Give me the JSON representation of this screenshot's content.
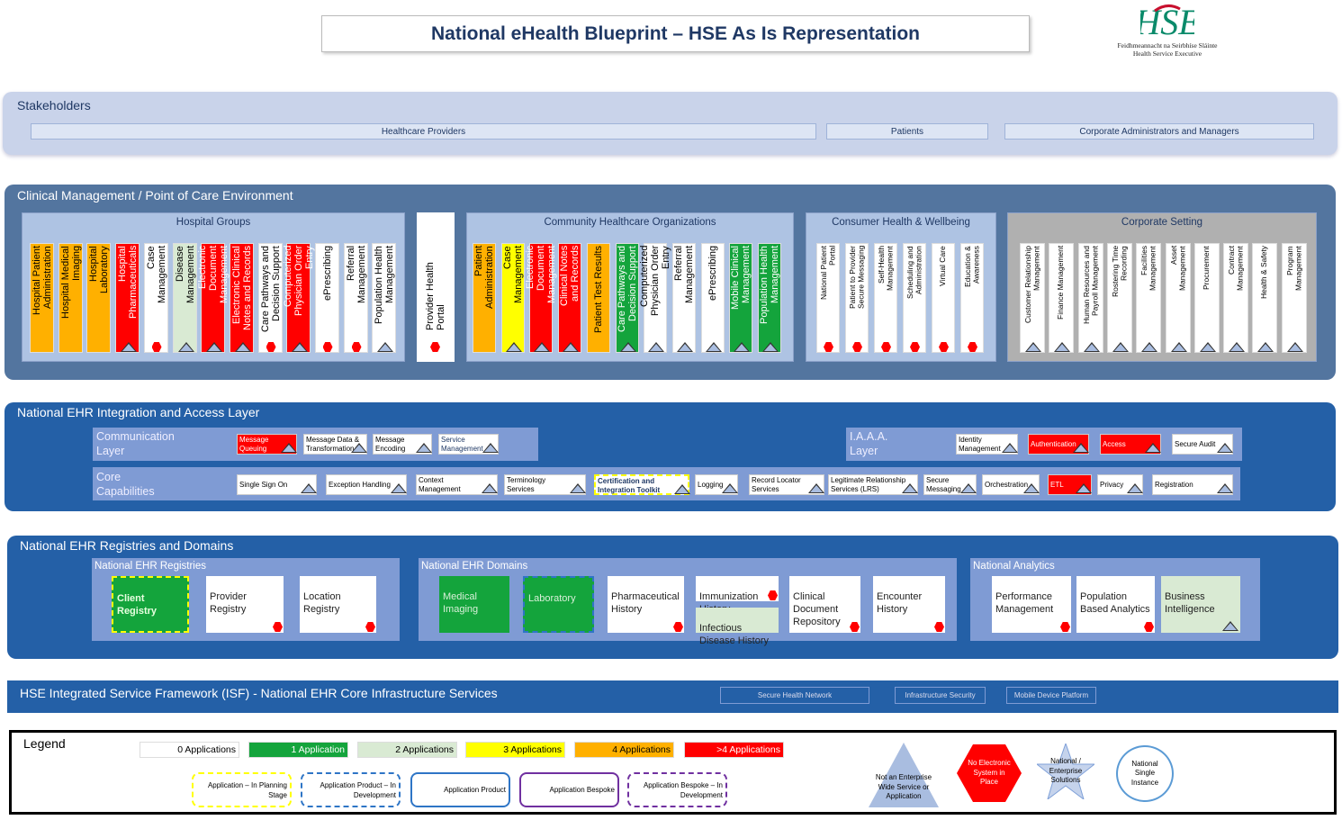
{
  "title": "National eHealth Blueprint – HSE As Is Representation",
  "logo": {
    "brand": "HSE",
    "line1": "Feidhmeannacht na Seirbhíse Sláinte",
    "line2": "Health Service Executive"
  },
  "colors": {
    "orange": "#ffb000",
    "red": "#ff0000",
    "green": "#14a43c",
    "lightgreen": "#d9ead3",
    "yellow": "#ffff00",
    "white": "#ffffff",
    "grey": "#b0b0b0",
    "navy": "#2460a7",
    "slate": "#53759f"
  },
  "stakeholders": {
    "title": "Stakeholders",
    "items": [
      "Healthcare Providers",
      "Patients",
      "Corporate Administrators and Managers"
    ]
  },
  "clinical": {
    "title": "Clinical Management / Point of Care Environment",
    "hospital": {
      "title": "Hospital Groups",
      "cols": [
        {
          "label": "Hospital Patient\nAdministration",
          "color": "orange",
          "marker": ""
        },
        {
          "label": "Hospital Medical\nImaging",
          "color": "orange",
          "marker": ""
        },
        {
          "label": "Hospital\nLaboratory",
          "color": "orange",
          "marker": ""
        },
        {
          "label": "Hospital\nPharmaceuticals",
          "color": "red",
          "marker": "tri"
        },
        {
          "label": "Case\nManagement",
          "color": "white",
          "marker": "hex"
        },
        {
          "label": "Disease\nManagement",
          "color": "lightgreen",
          "marker": "tri"
        },
        {
          "label": "Electronic Document\nManagement",
          "color": "red",
          "marker": "tri"
        },
        {
          "label": "Electronic Clinical\nNotes and Records",
          "color": "red",
          "marker": "tri"
        },
        {
          "label": "Care Pathways and\nDecision Support",
          "color": "white",
          "marker": "hex"
        },
        {
          "label": "Computerized\nPhysician Order Entry",
          "color": "red",
          "marker": "tri"
        },
        {
          "label": "ePrescribing",
          "color": "white",
          "marker": "hex"
        },
        {
          "label": "Referral\nManagement",
          "color": "white",
          "marker": "hex"
        },
        {
          "label": "Population Health\nManagement",
          "color": "white",
          "marker": "tri"
        }
      ]
    },
    "portal": {
      "label": "Provider Health Portal",
      "marker": "hex"
    },
    "community": {
      "title": "Community Healthcare Organizations",
      "cols": [
        {
          "label": "Patient\nAdministration",
          "color": "orange",
          "marker": ""
        },
        {
          "label": "Case\nManagement",
          "color": "yellow",
          "marker": "tri"
        },
        {
          "label": "Electronic Document\nManagement",
          "color": "red",
          "marker": "tri"
        },
        {
          "label": "Clinical Notes\nand Records",
          "color": "red",
          "marker": "tri"
        },
        {
          "label": "Patient Test Results",
          "color": "orange",
          "marker": ""
        },
        {
          "label": "Care Pathways and\nDecision Support",
          "color": "green",
          "marker": "tri"
        },
        {
          "label": "Computerized\nPhysician Order Entry",
          "color": "white",
          "marker": "tri"
        },
        {
          "label": "Referral\nManagement",
          "color": "white",
          "marker": "tri"
        },
        {
          "label": "ePrescribing",
          "color": "white",
          "marker": "tri"
        },
        {
          "label": "Mobile Clinical\nManagement",
          "color": "green",
          "marker": "tri"
        },
        {
          "label": "Population Health\nManagement",
          "color": "green",
          "marker": "tri"
        }
      ]
    },
    "consumer": {
      "title": "Consumer Health & Wellbeing",
      "cols": [
        {
          "label": "National Patient\nPortal",
          "color": "white",
          "marker": "hex"
        },
        {
          "label": "Patient to Provider\nSecure Messaging",
          "color": "white",
          "marker": "hex"
        },
        {
          "label": "Self-Health\nManagement",
          "color": "white",
          "marker": "hex"
        },
        {
          "label": "Scheduling and\nAdministration",
          "color": "white",
          "marker": "hex"
        },
        {
          "label": "Virtual Care",
          "color": "white",
          "marker": "hex"
        },
        {
          "label": "Education &\nAwareness",
          "color": "white",
          "marker": "hex"
        }
      ]
    },
    "corporate": {
      "title": "Corporate Setting",
      "cols": [
        {
          "label": "Customer Relationship\nManagement",
          "color": "white",
          "marker": "tri"
        },
        {
          "label": "Finance Management",
          "color": "white",
          "marker": "tri"
        },
        {
          "label": "Human Resources and\nPayroll Management",
          "color": "white",
          "marker": "tri"
        },
        {
          "label": "Rostering Time\nRecording",
          "color": "white",
          "marker": "tri"
        },
        {
          "label": "Facilities\nManagement",
          "color": "white",
          "marker": "tri"
        },
        {
          "label": "Asset\nManagement",
          "color": "white",
          "marker": "tri"
        },
        {
          "label": "Procurement",
          "color": "white",
          "marker": "tri"
        },
        {
          "label": "Contract\nManagement",
          "color": "white",
          "marker": "tri"
        },
        {
          "label": "Health & Safety",
          "color": "white",
          "marker": "tri"
        },
        {
          "label": "Program\nManagement",
          "color": "white",
          "marker": "tri"
        }
      ]
    }
  },
  "integration": {
    "title": "National EHR Integration and Access Layer",
    "comm": {
      "label_1": "Communication",
      "label_2": "Layer",
      "items": [
        {
          "label": "Message\nQueuing",
          "color": "red"
        },
        {
          "label": "Message Data &\nTransformation",
          "color": "white"
        },
        {
          "label": "Message\nEncoding",
          "color": "white"
        },
        {
          "label": "Service\nManagement",
          "color": "white",
          "navy": true
        }
      ]
    },
    "iaaa": {
      "label_1": "I.A.A.A.",
      "label_2": "Layer",
      "items": [
        {
          "label": "Identity\nManagement",
          "color": "white"
        },
        {
          "label": "Authentication",
          "color": "red"
        },
        {
          "label": "Access",
          "color": "red"
        },
        {
          "label": "Secure Audit",
          "color": "white"
        }
      ]
    },
    "core": {
      "label_1": "Core",
      "label_2": "Capabilities",
      "items": [
        {
          "label": "Single Sign On",
          "color": "white"
        },
        {
          "label": "Exception Handling",
          "color": "white"
        },
        {
          "label": "Context\nManagement",
          "color": "white"
        },
        {
          "label": "Terminology\nServices",
          "color": "white"
        },
        {
          "label": "Certification and\nIntegration Toolkit",
          "color": "white",
          "border": "planning",
          "navy": true
        },
        {
          "label": "Logging",
          "color": "white"
        },
        {
          "label": "Record Locator\nServices",
          "color": "white"
        },
        {
          "label": "Legitimate Relationship\nServices (LRS)",
          "color": "white"
        },
        {
          "label": "Secure\nMessaging",
          "color": "white"
        },
        {
          "label": "Orchestration",
          "color": "white"
        },
        {
          "label": "ETL",
          "color": "red"
        },
        {
          "label": "Privacy",
          "color": "white"
        },
        {
          "label": "Registration",
          "color": "white"
        }
      ]
    }
  },
  "registries": {
    "title": "National EHR Registries and Domains",
    "groups": [
      {
        "title": "National EHR Registries"
      },
      {
        "title": "National EHR Domains"
      },
      {
        "title": "National Analytics"
      }
    ],
    "tiles": [
      {
        "label": "Client Registry",
        "color": "green",
        "marker": "",
        "border": "planning",
        "bold": true
      },
      {
        "label": "Provider\nRegistry",
        "color": "white",
        "marker": "hex"
      },
      {
        "label": "Location\nRegistry",
        "color": "white",
        "marker": "hex"
      },
      {
        "label": "Medical\nImaging",
        "color": "green",
        "marker": ""
      },
      {
        "label": "Laboratory",
        "color": "green",
        "marker": "",
        "border": "product_dev"
      },
      {
        "label": "Pharmaceutical\nHistory",
        "color": "white",
        "marker": "hex"
      },
      {
        "label": "Immunization\nHistory",
        "color": "white",
        "marker": "hex"
      },
      {
        "label": "Infectious\nDisease History",
        "color": "lightgreen",
        "marker": ""
      },
      {
        "label": "Clinical\nDocument\nRepository",
        "color": "white",
        "marker": "hex"
      },
      {
        "label": "Encounter\nHistory",
        "color": "white",
        "marker": "hex"
      },
      {
        "label": "Performance\nManagement",
        "color": "white",
        "marker": "hex"
      },
      {
        "label": "Population\nBased Analytics",
        "color": "white",
        "marker": "hex"
      },
      {
        "label": "Business\nIntelligence",
        "color": "lightgreen",
        "marker": "tri"
      }
    ]
  },
  "isf": {
    "title": "HSE Integrated Service Framework (ISF) - National EHR Core Infrastructure Services",
    "buttons": [
      "Secure Health Network",
      "Infrastructure Security",
      "Mobile Device Platform"
    ]
  },
  "legend": {
    "title": "Legend",
    "counts": [
      {
        "label": "0 Applications",
        "color": "white"
      },
      {
        "label": "1 Application",
        "color": "green"
      },
      {
        "label": "2 Applications",
        "color": "lightgreen"
      },
      {
        "label": "3 Applications",
        "color": "yellow"
      },
      {
        "label": "4 Applications",
        "color": "orange"
      },
      {
        "label": ">4 Applications",
        "color": "red"
      }
    ],
    "borders": [
      {
        "label": "Application – In Planning Stage",
        "style": "dashed",
        "color": "#ffff00"
      },
      {
        "label": "Application Product – In Development",
        "style": "dashed",
        "color": "#2e75c6"
      },
      {
        "label": "Application Product",
        "style": "solid",
        "color": "#2e75c6"
      },
      {
        "label": "Application Bespoke",
        "style": "solid",
        "color": "#7030a0"
      },
      {
        "label": "Application Bespoke – In Development",
        "style": "dashed",
        "color": "#7030a0"
      }
    ],
    "shapes": [
      {
        "label": "Not an Enterprise Wide Service or Application",
        "shape": "triangle"
      },
      {
        "label": "No Electronic System in Place",
        "shape": "hexagon"
      },
      {
        "label": "National / Enterprise Solutions",
        "shape": "star"
      },
      {
        "label": "National Single Instance",
        "shape": "circle"
      }
    ]
  }
}
